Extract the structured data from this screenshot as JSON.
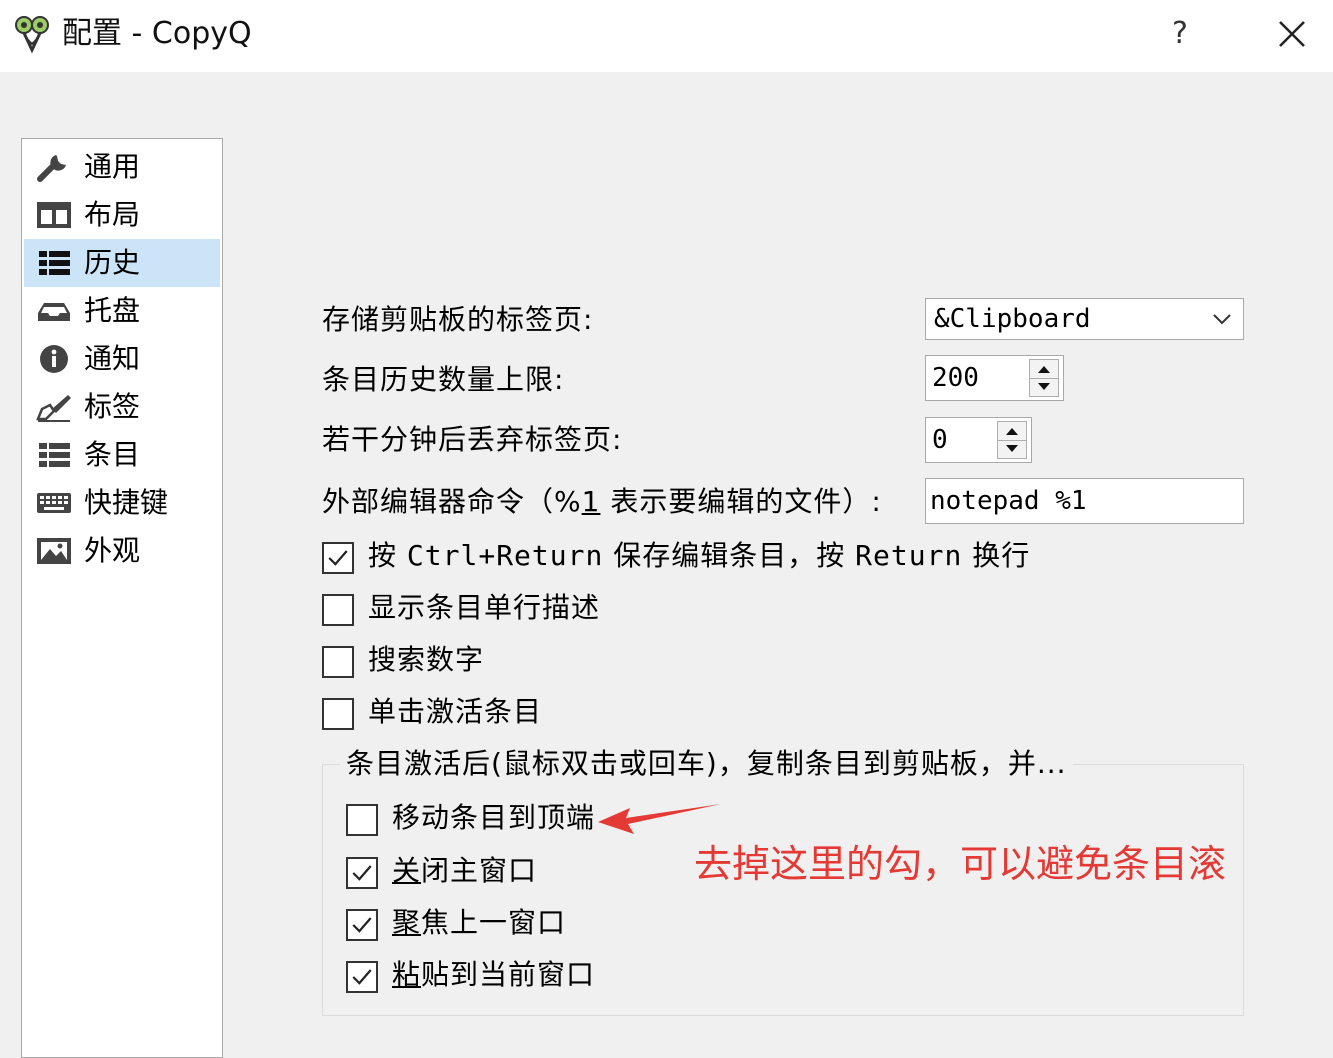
{
  "window": {
    "title": "配置 - CopyQ",
    "help_label": "?",
    "icons": {
      "app": "copyq-app-icon",
      "close": "close-icon"
    }
  },
  "sidebar": {
    "items": [
      {
        "label": "通用",
        "icon": "wrench-icon",
        "selected": false
      },
      {
        "label": "布局",
        "icon": "layout-icon",
        "selected": false
      },
      {
        "label": "历史",
        "icon": "history-list-icon",
        "selected": true
      },
      {
        "label": "托盘",
        "icon": "tray-icon",
        "selected": false
      },
      {
        "label": "通知",
        "icon": "info-icon",
        "selected": false
      },
      {
        "label": "标签",
        "icon": "tag-pen-icon",
        "selected": false
      },
      {
        "label": "条目",
        "icon": "items-list-icon",
        "selected": false
      },
      {
        "label": "快捷键",
        "icon": "keyboard-icon",
        "selected": false
      },
      {
        "label": "外观",
        "icon": "appearance-image-icon",
        "selected": false
      }
    ],
    "selected_color": "#cce4f7"
  },
  "history": {
    "clipboard_tab_label": "存储剪贴板的标签页:",
    "clipboard_tab_value": "&Clipboard",
    "max_items_label": "条目历史数量上限:",
    "max_items_value": "200",
    "unload_tabs_label": "若干分钟后丢弃标签页:",
    "unload_tabs_value": "0",
    "editor_label_pre": "外部编辑器命令（%",
    "editor_label_u": "1",
    "editor_label_post": " 表示要编辑的文件）:",
    "editor_value": "notepad %1",
    "checkboxes": [
      {
        "pre": "按 ",
        "mono1": "Ctrl+Return",
        "mid": " 保存编辑条目，按 ",
        "mono2": "Return",
        "post": " 换行",
        "checked": true
      },
      {
        "label": "显示条目单行描述",
        "checked": false
      },
      {
        "label": "搜索数字",
        "checked": false
      },
      {
        "label": "单击激活条目",
        "checked": false
      }
    ],
    "activate_group": {
      "title": "条目激活后(鼠标双击或回车)，复制条目到剪贴板，并...",
      "options": [
        {
          "label": "移动条目到顶端",
          "checked": false
        },
        {
          "u": "关",
          "label": "闭主窗口",
          "checked": true
        },
        {
          "u": "聚",
          "label": "焦上一窗口",
          "checked": true
        },
        {
          "u": "粘",
          "label": "贴到当前窗口",
          "checked": true
        }
      ]
    }
  },
  "annotation": {
    "text": "去掉这里的勾，可以避免条目滚",
    "color": "#e53935"
  }
}
